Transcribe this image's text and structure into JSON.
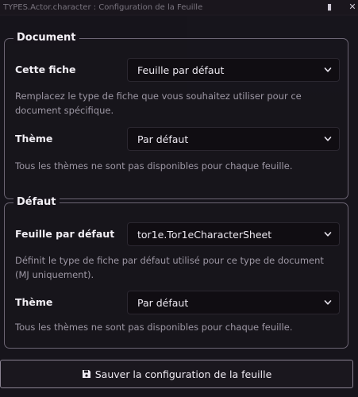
{
  "window": {
    "title": "TYPES.Actor.character : Configuration de la Feuille"
  },
  "document": {
    "legend": "Document",
    "sheet_label": "Cette fiche",
    "sheet_value": "Feuille par défaut",
    "sheet_hint": "Remplacez le type de fiche que vous souhaitez utiliser pour ce document spécifique.",
    "theme_label": "Thème",
    "theme_value": "Par défaut",
    "theme_hint": "Tous les thèmes ne sont pas disponibles pour chaque feuille."
  },
  "default": {
    "legend": "Défaut",
    "sheet_label": "Feuille par défaut",
    "sheet_value": "tor1e.Tor1eCharacterSheet",
    "sheet_hint": "Définit le type de fiche par défaut utilisé pour ce type de document (MJ uniquement).",
    "theme_label": "Thème",
    "theme_value": "Par défaut",
    "theme_hint": "Tous les thèmes ne sont pas disponibles pour chaque feuille."
  },
  "footer": {
    "save_label": "Sauver la configuration de la feuille"
  },
  "icons": {
    "dropdown": "chevron-down-icon",
    "save": "save-icon",
    "window_close": "close-icon",
    "window_other": "window-icon"
  },
  "colors": {
    "border": "#6c6574",
    "hint_text": "#9d97a4",
    "select_bg": "#100d12"
  }
}
